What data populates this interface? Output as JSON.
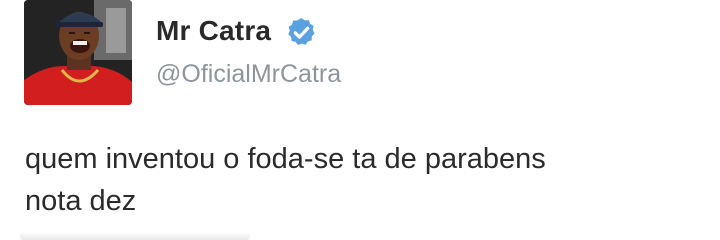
{
  "tweet": {
    "display_name": "Mr Catra",
    "handle": "@OficialMrCatra",
    "verified": true,
    "text_lines": [
      "quem inventou o foda-se ta de parabens",
      "nota dez"
    ]
  },
  "icons": {
    "avatar": "profile-photo",
    "badge": "verified-badge-icon"
  },
  "colors": {
    "verified_blue": "#5aa1e0",
    "name": "#2a2a2a",
    "handle": "#8e959b",
    "text": "#2b2b2b"
  }
}
